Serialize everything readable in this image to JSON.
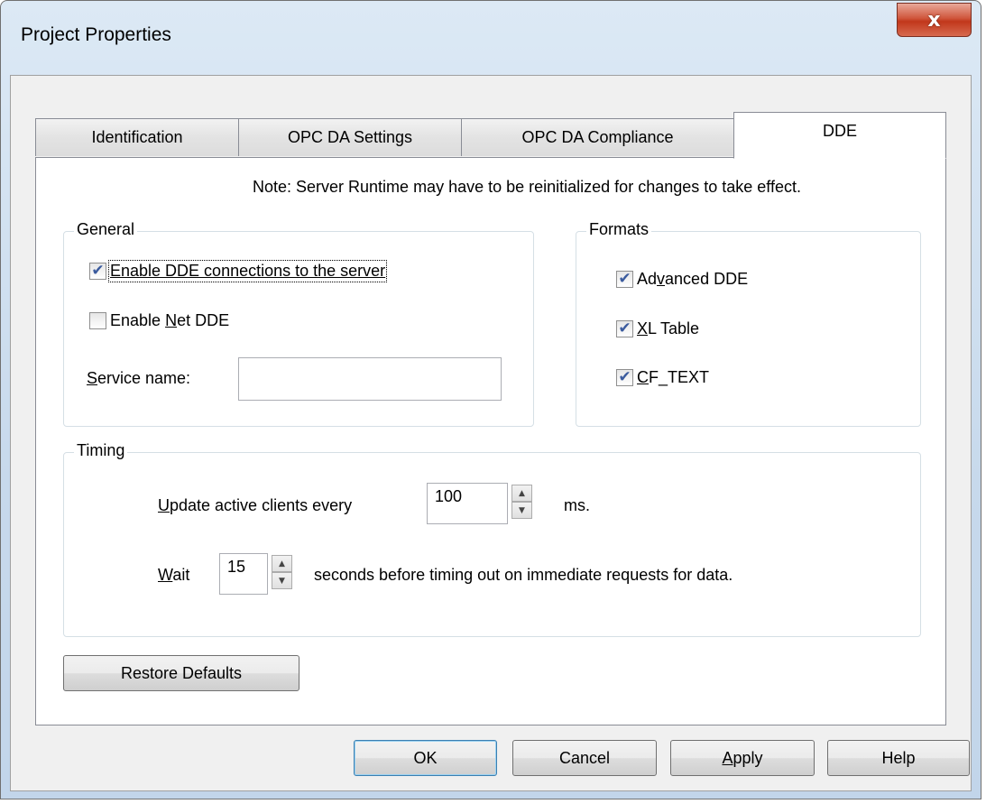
{
  "window": {
    "title": "Project Properties",
    "close_glyph": "x"
  },
  "tabs": [
    {
      "label": "Identification"
    },
    {
      "label": "OPC DA Settings"
    },
    {
      "label": "OPC DA Compliance"
    },
    {
      "label": "DDE",
      "active": true
    }
  ],
  "note": "Note: Server Runtime may have to be reinitialized for changes to take effect.",
  "general": {
    "label": "General",
    "enable_dde": {
      "label": "Enable DDE connections to the server",
      "checked": true
    },
    "enable_net_dde": {
      "label_pre": "Enable ",
      "label_u": "N",
      "label_post": "et DDE",
      "checked": false
    },
    "service_name": {
      "label_u": "S",
      "label_post": "ervice name:",
      "value": ""
    }
  },
  "formats": {
    "label": "Formats",
    "advanced_dde": {
      "label_pre": "Ad",
      "label_u": "v",
      "label_post": "anced DDE",
      "checked": true
    },
    "xl_table": {
      "label_u": "X",
      "label_post": "L Table",
      "checked": true
    },
    "cf_text": {
      "label_u": "C",
      "label_post": "F_TEXT",
      "checked": true
    }
  },
  "timing": {
    "label": "Timing",
    "update": {
      "label_u": "U",
      "label_post": "pdate active clients every",
      "value": "100",
      "unit": "ms."
    },
    "wait": {
      "label_u": "W",
      "label_post": "ait",
      "value": "15",
      "suffix": "seconds before timing out on immediate requests for data."
    }
  },
  "buttons": {
    "restore_defaults": "Restore Defaults",
    "ok": "OK",
    "cancel": "Cancel",
    "apply_u": "A",
    "apply_post": "pply",
    "help": "Help"
  },
  "icons": {
    "check": "✔",
    "spin_up": "▲",
    "spin_down": "▼"
  }
}
